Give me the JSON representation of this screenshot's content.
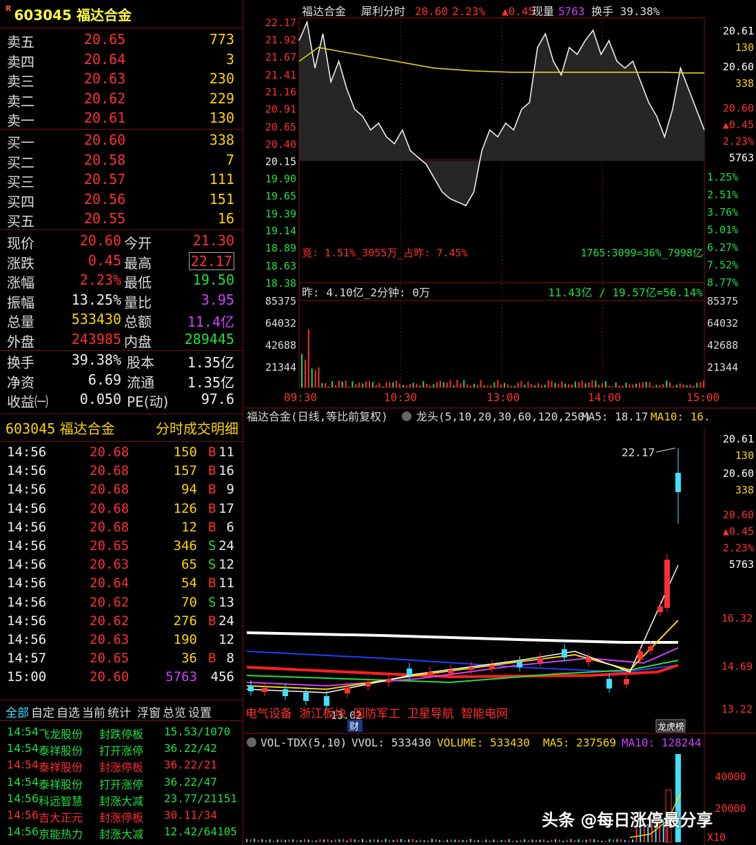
{
  "stock": {
    "flag": "R",
    "code": "603045",
    "name": "福达合金"
  },
  "orderbook": {
    "sell": [
      {
        "label": "卖五",
        "price": "20.65",
        "vol": "773"
      },
      {
        "label": "卖四",
        "price": "20.64",
        "vol": "3"
      },
      {
        "label": "卖三",
        "price": "20.63",
        "vol": "230"
      },
      {
        "label": "卖二",
        "price": "20.62",
        "vol": "229"
      },
      {
        "label": "卖一",
        "price": "20.61",
        "vol": "130"
      }
    ],
    "buy": [
      {
        "label": "买一",
        "price": "20.60",
        "vol": "338"
      },
      {
        "label": "买二",
        "price": "20.58",
        "vol": "7"
      },
      {
        "label": "买三",
        "price": "20.57",
        "vol": "111"
      },
      {
        "label": "买四",
        "price": "20.56",
        "vol": "151"
      },
      {
        "label": "买五",
        "price": "20.55",
        "vol": "16"
      }
    ]
  },
  "quote": [
    {
      "l1": "现价",
      "v1": "20.60",
      "c1": "red",
      "l2": "今开",
      "v2": "21.30",
      "c2": "red"
    },
    {
      "l1": "涨跌",
      "v1": "0.45",
      "c1": "red",
      "l2": "最高",
      "v2": "22.17",
      "c2": "red"
    },
    {
      "l1": "涨幅",
      "v1": "2.23%",
      "c1": "red",
      "l2": "最低",
      "v2": "19.50",
      "c2": "green"
    },
    {
      "l1": "振幅",
      "v1": "13.25%",
      "c1": "white",
      "l2": "量比",
      "v2": "3.95",
      "c2": "purple"
    },
    {
      "l1": "总量",
      "v1": "533430",
      "c1": "yellow",
      "l2": "总额",
      "v2": "11.4亿",
      "c2": "purple"
    },
    {
      "l1": "外盘",
      "v1": "243985",
      "c1": "red",
      "l2": "内盘",
      "v2": "289445",
      "c2": "green"
    }
  ],
  "quote2": [
    {
      "l1": "换手",
      "v1": "39.38%",
      "l2": "股本",
      "v2": "1.35亿"
    },
    {
      "l1": "净资",
      "v1": "6.69",
      "l2": "流通",
      "v2": "1.35亿"
    },
    {
      "l1": "收益㈠",
      "v1": "0.050",
      "l2": "PE(动)",
      "v2": "97.6"
    }
  ],
  "ticks_header": {
    "code": "603045",
    "name": "福达合金",
    "title": "分时成交明细"
  },
  "ticks": [
    {
      "t": "14:56",
      "p": "20.68",
      "v": "150",
      "d": "B",
      "n": "11"
    },
    {
      "t": "14:56",
      "p": "20.68",
      "v": "157",
      "d": "B",
      "n": "16"
    },
    {
      "t": "14:56",
      "p": "20.68",
      "v": "94",
      "d": "B",
      "n": "9"
    },
    {
      "t": "14:56",
      "p": "20.68",
      "v": "126",
      "d": "B",
      "n": "17"
    },
    {
      "t": "14:56",
      "p": "20.68",
      "v": "12",
      "d": "B",
      "n": "6"
    },
    {
      "t": "14:56",
      "p": "20.65",
      "v": "346",
      "d": "S",
      "n": "24"
    },
    {
      "t": "14:56",
      "p": "20.63",
      "v": "65",
      "d": "S",
      "n": "12"
    },
    {
      "t": "14:56",
      "p": "20.64",
      "v": "54",
      "d": "B",
      "n": "11"
    },
    {
      "t": "14:56",
      "p": "20.62",
      "v": "70",
      "d": "S",
      "n": "13"
    },
    {
      "t": "14:56",
      "p": "20.62",
      "v": "276",
      "d": "B",
      "n": "24"
    },
    {
      "t": "14:56",
      "p": "20.63",
      "v": "190",
      "d": "",
      "n": "12"
    },
    {
      "t": "14:57",
      "p": "20.65",
      "v": "36",
      "d": "B",
      "n": "8"
    },
    {
      "t": "15:00",
      "p": "20.60",
      "v": "5763",
      "d": "",
      "n": "456"
    }
  ],
  "tabs": [
    "全部",
    "自定",
    "自选",
    "当前",
    "统计",
    "浮窗",
    "总览",
    "设置"
  ],
  "news": [
    {
      "t": "14:54",
      "name": "飞龙股份",
      "act": "封跌停板",
      "val": "15.53/1070",
      "c": "green"
    },
    {
      "t": "14:54",
      "name": "泰祥股份",
      "act": "打开涨停",
      "val": "36.22/42",
      "c": "green"
    },
    {
      "t": "14:54",
      "name": "泰祥股份",
      "act": "封涨停板",
      "val": "36.22/21",
      "c": "red"
    },
    {
      "t": "14:54",
      "name": "泰祥股份",
      "act": "打开涨停",
      "val": "36.22/47",
      "c": "green"
    },
    {
      "t": "14:56",
      "name": "科远智慧",
      "act": "封涨大减",
      "val": "23.77/21151",
      "c": "green"
    },
    {
      "t": "14:56",
      "name": "吉大正元",
      "act": "封涨停板",
      "val": "30.11/34",
      "c": "red"
    },
    {
      "t": "14:56",
      "name": "京能热力",
      "act": "封涨大减",
      "val": "12.42/64105",
      "c": "green"
    }
  ],
  "intraday": {
    "title_name": "福达合金",
    "title_type": "犀利分时",
    "price": "20.60",
    "pct": "2.23%",
    "chg": "▲0.45",
    "vol_label": "现量",
    "vol": "5763",
    "turn": "换手 39.38%",
    "left_ticks": [
      "22.17",
      "21.92",
      "21.67",
      "21.41",
      "21.16",
      "20.91",
      "20.65",
      "20.40",
      "20.15",
      "19.90",
      "19.65",
      "19.39",
      "19.14",
      "18.89",
      "18.63",
      "18.38"
    ],
    "right_pct": [
      "1.25%",
      "2.51%",
      "3.76%",
      "5.01%",
      "6.27%",
      "7.52%",
      "8.77%"
    ],
    "right_top": [
      "20.61",
      "130",
      "20.60",
      "338",
      "20.60",
      "▲0.45",
      "2.23%",
      "5763"
    ],
    "auction": "竞: 1.51%_3055万_占昨: 7.45%",
    "ratio": "1765:3099=36%_7998亿",
    "yesterday": "昨: 4.10亿_2分钟: 0万",
    "amount": "11.43亿 / 19.57亿=56.14%",
    "vol_ticks": [
      "85375",
      "64032",
      "42688",
      "21344"
    ],
    "time_ticks": [
      "09:30",
      "10:30",
      "13:00",
      "14:00",
      "15:00"
    ],
    "price_series": [
      21.9,
      22.17,
      21.5,
      22.0,
      21.3,
      21.6,
      21.2,
      20.9,
      20.8,
      20.6,
      20.7,
      20.5,
      20.4,
      20.6,
      20.3,
      20.2,
      20.1,
      19.9,
      19.7,
      19.6,
      19.55,
      19.5,
      19.7,
      20.3,
      20.6,
      20.5,
      20.7,
      20.6,
      20.9,
      21.0,
      21.8,
      22.0,
      21.6,
      21.4,
      21.8,
      21.7,
      21.9,
      22.05,
      21.7,
      21.9,
      21.6,
      21.5,
      21.6,
      21.3,
      21.0,
      20.8,
      20.5,
      20.9,
      21.5,
      21.2,
      20.9,
      20.6
    ],
    "avg_series": [
      21.6,
      21.8,
      21.75,
      21.7,
      21.65,
      21.6,
      21.55,
      21.5,
      21.48,
      21.46,
      21.45,
      21.44,
      21.44,
      21.44,
      21.44,
      21.44,
      21.44,
      21.44,
      21.44,
      21.44,
      21.43,
      21.43
    ]
  },
  "daily": {
    "title": "福达合金(日线,等比前复权)",
    "indicator": "龙头(5,10,20,30,60,120,250)",
    "ma5": "MA5: 18.17",
    "ma10": "MA10: 16.",
    "high_label": "22.17",
    "low_label": "13.02",
    "fin_label": "财",
    "concepts": "电气设备 浙江板块 国防军工 卫星导航 智能电网",
    "badge": "龙虎榜",
    "right_ticks": [
      "20.61",
      "130",
      "20.60",
      "338",
      "20.60",
      "▲0.45",
      "2.23%",
      "5763"
    ],
    "axis": [
      "16.32",
      "14.69",
      "13.22"
    ]
  },
  "volume": {
    "label": "VOL-TDX(5,10)",
    "vvol": "VVOL: 533430",
    "volume": "VOLUME: 533430",
    "ma5": "MA5: 237569",
    "ma10": "MA10: 128244",
    "ticks": [
      "40000",
      "20000"
    ],
    "unit": "X10"
  },
  "watermark": "头条 @每日涨停最分享"
}
